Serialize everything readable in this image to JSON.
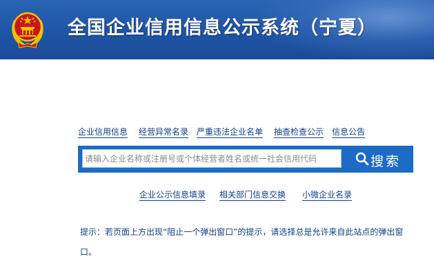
{
  "header": {
    "title": "全国企业信用信息公示系统（宁夏）",
    "emblem_icon": "national-emblem-icon",
    "colors": {
      "header_blue": "#1f54a6",
      "emblem_red": "#c8161d",
      "emblem_gold": "#f2c200"
    }
  },
  "nav": {
    "items": [
      {
        "label": "企业信用信息"
      },
      {
        "label": "经营异常名录"
      },
      {
        "label": "严重违法企业名单"
      },
      {
        "label": "抽查检查公示"
      },
      {
        "label": "信息公告"
      }
    ]
  },
  "search": {
    "placeholder": "请输入企业名称或注册号或个体经营者姓名或统一社会信用代码",
    "value": "",
    "button_label": "搜索",
    "button_icon": "search-icon",
    "bar_color": "#1c6bc5"
  },
  "sublinks": {
    "items": [
      {
        "label": "企业公示信息填录"
      },
      {
        "label": "相关部门信息交换"
      },
      {
        "label": "小微企业名录"
      }
    ]
  },
  "tip": {
    "text": "提示：若页面上方出现“阻止一个弹出窗口”的提示，请选择总是允许来自此站点的弹出窗口。"
  }
}
